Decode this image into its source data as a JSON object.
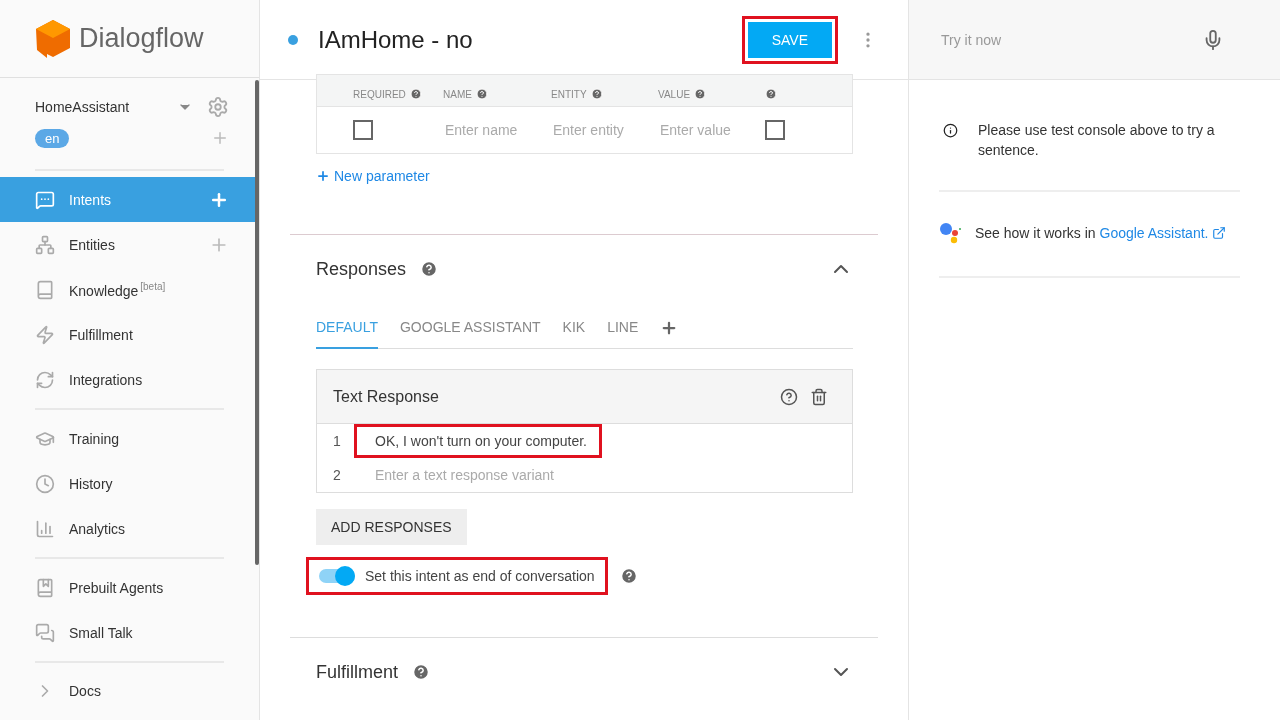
{
  "logo": {
    "name": "Dialogflow"
  },
  "sidebar": {
    "agent": "HomeAssistant",
    "language": "en",
    "groups": [
      [
        {
          "label": "Intents",
          "selected": true,
          "add": true
        },
        {
          "label": "Entities",
          "selected": false,
          "add": true
        },
        {
          "label": "Knowledge",
          "sup": "[beta]",
          "selected": false,
          "add": false
        },
        {
          "label": "Fulfillment",
          "selected": false,
          "add": false
        },
        {
          "label": "Integrations",
          "selected": false,
          "add": false
        }
      ],
      [
        {
          "label": "Training",
          "selected": false,
          "add": false
        },
        {
          "label": "History",
          "selected": false,
          "add": false
        },
        {
          "label": "Analytics",
          "selected": false,
          "add": false
        }
      ],
      [
        {
          "label": "Prebuilt Agents",
          "selected": false,
          "add": false
        },
        {
          "label": "Small Talk",
          "selected": false,
          "add": false
        }
      ],
      [
        {
          "label": "Docs",
          "selected": false,
          "add": false
        }
      ]
    ]
  },
  "header": {
    "title": "IAmHome - no",
    "save": {
      "label": "SAVE",
      "highlighted": true
    }
  },
  "parameters": {
    "columns": [
      {
        "label": "REQUIRED"
      },
      {
        "label": "NAME"
      },
      {
        "label": "ENTITY"
      },
      {
        "label": "VALUE"
      },
      {}
    ],
    "row": {
      "required": false,
      "name_placeholder": "Enter name",
      "entity_placeholder": "Enter entity",
      "value_placeholder": "Enter value",
      "column_5_checked": false
    },
    "new_link": "New parameter"
  },
  "responses": {
    "title": "Responses",
    "expanded": true,
    "tabs": [
      {
        "label": "DEFAULT",
        "selected": true
      },
      {
        "label": "GOOGLE ASSISTANT",
        "selected": false
      },
      {
        "label": "KIK",
        "selected": false
      },
      {
        "label": "LINE",
        "selected": false
      }
    ],
    "card": {
      "title": "Text Response",
      "lines": [
        {
          "number": "1",
          "value": "OK, I won't turn on your computer.",
          "highlighted": true
        },
        {
          "number": "2",
          "placeholder": "Enter a text response variant",
          "highlighted": false
        }
      ]
    },
    "add_button": "ADD RESPONSES",
    "end_toggle": {
      "label": "Set this intent as end of conversation",
      "on": true,
      "highlighted": true
    }
  },
  "fulfillment": {
    "title": "Fulfillment",
    "expanded": false
  },
  "console": {
    "placeholder": "Try it now",
    "info": "Please use test console above to try a sentence.",
    "assistant_text": "See how it works in",
    "assistant_link": "Google Assistant."
  }
}
